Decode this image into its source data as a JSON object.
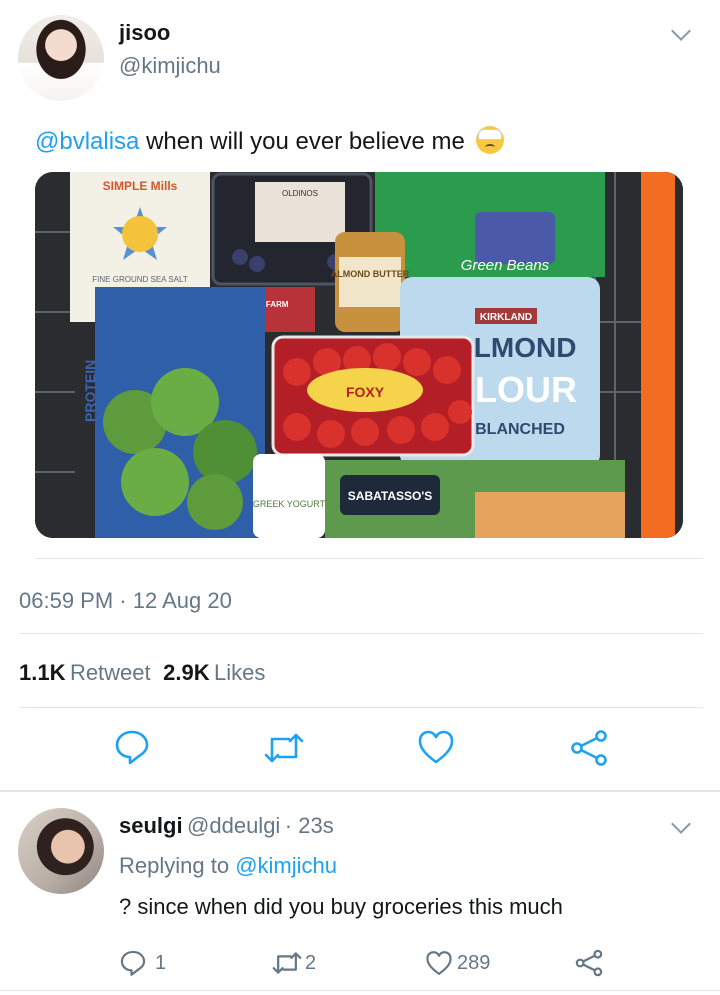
{
  "tweet": {
    "author": {
      "name": "jisoo",
      "handle": "@kimjichu"
    },
    "text": {
      "mention": "@bvlalisa",
      "body": " when will you ever believe me"
    },
    "emoji": "head-bandage-emoji",
    "media": {
      "labels": {
        "simple_mills": "SIMPLE Mills",
        "sea_salt": "FINE GROUND SEA SALT",
        "odinos": "OLDINOS",
        "hillshire": "HILLSHIRE FARM",
        "foxy": "FOXY",
        "kirkland": "KIRKLAND",
        "almond": "ALMOND",
        "flour": "FLOUR",
        "blanched": "BLANCHED",
        "green_beans": "Green Beans",
        "sabatassos": "SABATASSO'S",
        "yogurt": "GREEK YOGURT",
        "almond_butter": "ALMOND BUTTER",
        "protein": "PROTEIN"
      }
    },
    "timestamp": "06:59 PM · 12 Aug 20",
    "stats": {
      "retweets": "1.1K",
      "retweets_label": "Retweet",
      "likes": "2.9K",
      "likes_label": "Likes"
    }
  },
  "reply": {
    "author": {
      "name": "seulgi",
      "handle": "@ddeulgi",
      "time": "· 23s"
    },
    "replying_to_label": "Replying to",
    "replying_to_handle": "@kimjichu",
    "text": "? since when did you buy groceries this much",
    "counts": {
      "replies": "1",
      "retweets": "2",
      "likes": "289"
    }
  },
  "colors": {
    "accent": "#1da1f2",
    "secondary": "#657786",
    "divider": "#e1e8ed",
    "icon": "#1da1f2"
  },
  "icons": [
    "chevron-down-icon",
    "reply-icon",
    "retweet-icon",
    "like-icon",
    "share-icon"
  ]
}
